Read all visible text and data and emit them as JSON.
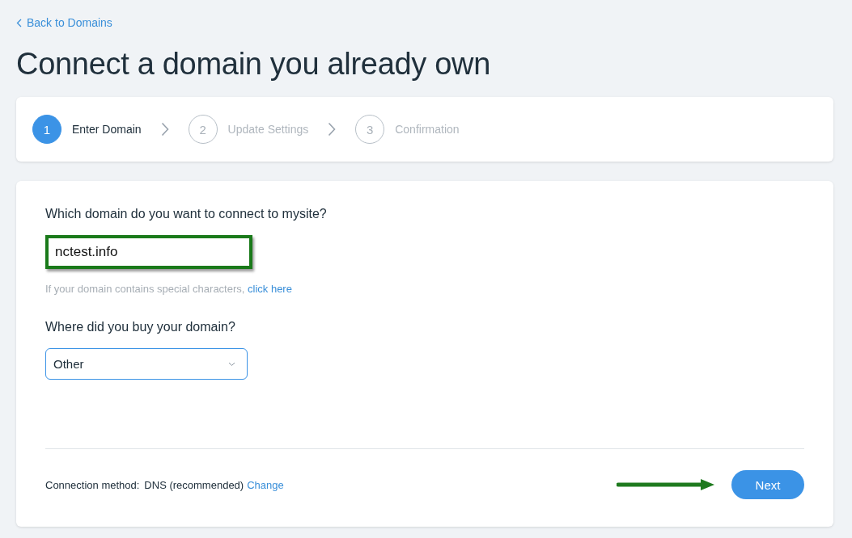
{
  "back_link": "Back to Domains",
  "title": "Connect a domain you already own",
  "steps": [
    {
      "number": "1",
      "label": "Enter Domain",
      "selected": true
    },
    {
      "number": "2",
      "label": "Update Settings",
      "selected": false
    },
    {
      "number": "3",
      "label": "Confirmation",
      "selected": false
    }
  ],
  "form": {
    "domain_question": "Which domain do you want to connect to mysite?",
    "domain_value": "nctest.info",
    "hint": "If your domain contains special characters,",
    "hint_link": "click here",
    "registrar_question": "Where did you buy your domain?",
    "registrar_value": "Other"
  },
  "footer": {
    "method_label": "Connection method:",
    "method_value": "DNS (recommended)",
    "change_link": "Change",
    "next_button": "Next"
  }
}
